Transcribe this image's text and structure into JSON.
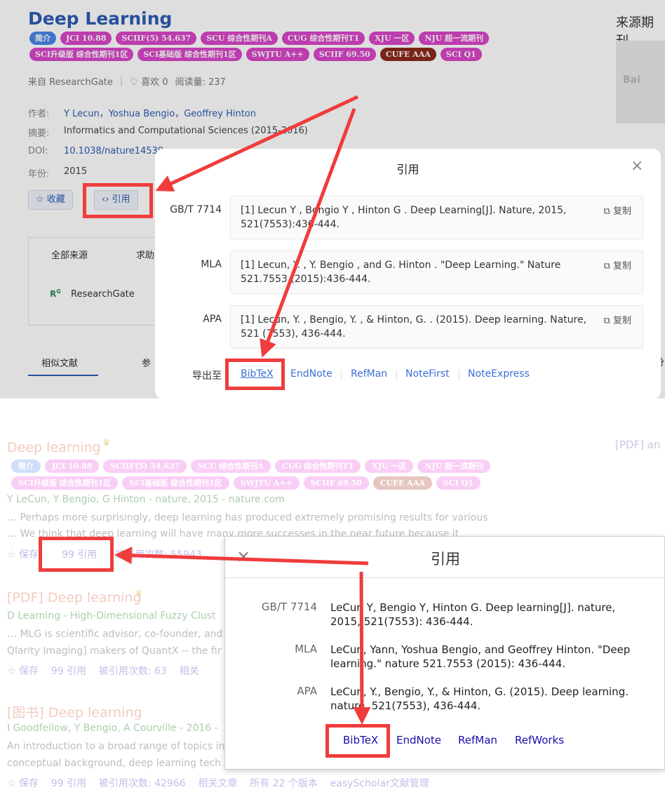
{
  "top": {
    "title": "Deep Learning",
    "tags_row1": [
      {
        "text": "简介",
        "color": "blue"
      },
      {
        "text": "JCI 10.88",
        "color": "pink"
      },
      {
        "text": "SCIIF(5) 54.637",
        "color": "pink"
      },
      {
        "text": "SCU 综合性期刊A",
        "color": "pink"
      },
      {
        "text": "CUG 综合性期刊T1",
        "color": "pink"
      },
      {
        "text": "XJU 一区",
        "color": "pink"
      },
      {
        "text": "NJU 超一流期刊",
        "color": "pink"
      }
    ],
    "tags_row2": [
      {
        "text": "SCI升级版 综合性期刊1区",
        "color": "pink"
      },
      {
        "text": "SCI基础版 综合性期刊1区",
        "color": "pink"
      },
      {
        "text": "SWJTU A++",
        "color": "pink"
      },
      {
        "text": "SCIIF 69.50",
        "color": "pink"
      },
      {
        "text": "CUFE AAA",
        "color": "dark"
      },
      {
        "text": "SCI Q1",
        "color": "pink"
      }
    ],
    "source": "来自 ResearchGate",
    "likes": "♡ 喜欢 0",
    "reads": "阅读量: 237",
    "authors_label": "作者:",
    "authors": "Y Lecun，Yoshua Bengio，Geoffrey Hinton",
    "abstract_label": "摘要:",
    "abstract": "Informatics and Computational Sciences (2015-2016)",
    "doi_label": "DOI:",
    "doi": "10.1038/nature14539",
    "year_label": "年份:",
    "year": "2015",
    "collect_btn": "☆ 收藏",
    "cite_btn": "‹› 引用",
    "tab_all_sources": "全部来源",
    "tab_help": "求助",
    "source_name": "ResearchGate",
    "tab_similar": "相似文献",
    "tab_ref": "参",
    "right_title": "来源期刊",
    "right_partial": "分"
  },
  "dialog1": {
    "title": "引用",
    "close": "×",
    "rows": [
      {
        "label": "GB/T 7714",
        "text": "[1] Lecun Y , Bengio Y , Hinton G . Deep Learning[J]. Nature, 2015, 521(7553):436-444.",
        "copy": "复制"
      },
      {
        "label": "MLA",
        "text": "[1] Lecun, Y. , Y. Bengio , and G. Hinton . \"Deep Learning.\" Nature 521.7553 (2015):436-444.",
        "copy": "复制"
      },
      {
        "label": "APA",
        "text": "[1] Lecun, Y. , Bengio, Y. , & Hinton, G. . (2015). Deep learning. Nature, 521 (7553), 436-444.",
        "copy": "复制"
      }
    ],
    "export_label": "导出至",
    "export_links": [
      "BibTeX",
      "EndNote",
      "RefMan",
      "NoteFirst",
      "NoteExpress"
    ]
  },
  "bottom": {
    "r1_title": "Deep learning",
    "r1_pdf": "[PDF] an",
    "tags_row1": [
      {
        "text": "简介",
        "color": "blue"
      },
      {
        "text": "JCI 10.88",
        "color": "pink"
      },
      {
        "text": "SCIIF(5) 54.637",
        "color": "pink"
      },
      {
        "text": "SCU 综合性期刊A",
        "color": "pink"
      },
      {
        "text": "CUG 综合性期刊T1",
        "color": "pink"
      },
      {
        "text": "XJU 一区",
        "color": "pink"
      },
      {
        "text": "NJU 超一流期刊",
        "color": "pink"
      }
    ],
    "tags_row2": [
      {
        "text": "SCI升级版 综合性期刊1区",
        "color": "pink"
      },
      {
        "text": "SCI基础版 综合性期刊1区",
        "color": "pink"
      },
      {
        "text": "SWJTU A++",
        "color": "pink"
      },
      {
        "text": "SCIIF 69.50",
        "color": "pink"
      },
      {
        "text": "CUFE AAA",
        "color": "dark"
      },
      {
        "text": "SCI Q1",
        "color": "pink"
      }
    ],
    "r1_authors": "Y LeCun, Y Bengio, G Hinton - nature, 2015 - nature.com",
    "r1_snip1": "… Perhaps more surprisingly, deep learning has produced extremely promising results for various",
    "r1_snip2": "… We think that deep learning will have many more successes in the near future because it",
    "r1_save": "☆ 保存",
    "r1_cite": "99 引用",
    "r1_citedby": "被引用次数: 55943",
    "r2_title": "[PDF] Deep learning",
    "r2_authors": "D Learning - High-Dimensional Fuzzy Clust",
    "r2_snip1": "… MLG is scientific advisor, co-founder, and",
    "r2_snip2": "Qlarity Imaging] makers of QuantX -- the fir",
    "r2_actions": "☆ 保存    99 引用    被引用次数: 63    相关",
    "r3_title": "[图书] Deep learning",
    "r3_authors": "I Goodfellow, Y Bengio, A Courville - 2016 -",
    "r3_snip1": "An introduction to a broad range of topics in",
    "r3_snip2": "conceptual background, deep learning tech",
    "r3_actions": "☆ 保存    99 引用    被引用次数: 42966    相关文章    所有 22 个版本    easyScholar文献管理"
  },
  "dialog2": {
    "title": "引用",
    "close": "×",
    "rows": [
      {
        "label": "GB/T 7714",
        "text": "LeCun Y, Bengio Y, Hinton G. Deep learning[J]. nature, 2015, 521(7553): 436-444."
      },
      {
        "label": "MLA",
        "text": "LeCun, Yann, Yoshua Bengio, and Geoffrey Hinton. \"Deep learning.\" nature 521.7553 (2015): 436-444."
      },
      {
        "label": "APA",
        "text": "LeCun, Y., Bengio, Y., & Hinton, G. (2015). Deep learning. nature, 521(7553), 436-444."
      }
    ],
    "export_links": [
      "BibTeX",
      "EndNote",
      "RefMan",
      "RefWorks"
    ]
  }
}
